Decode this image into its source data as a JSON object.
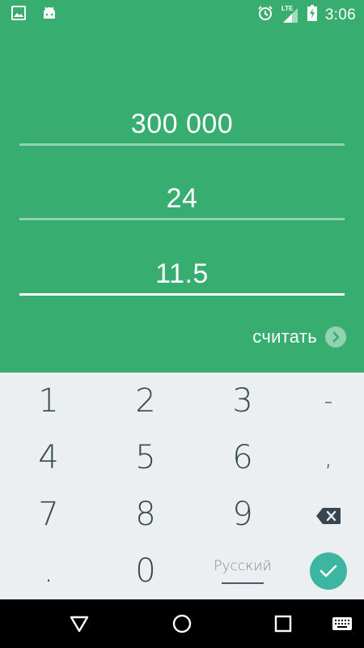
{
  "status_bar": {
    "time": "3:06",
    "network": "LTE",
    "icons": [
      "image-icon",
      "android-icon",
      "alarm-icon",
      "signal-icon",
      "battery-charging-icon"
    ]
  },
  "form": {
    "amount": "300 000",
    "term": "24",
    "rate": "11.5",
    "calculate_label": "считать"
  },
  "keyboard": {
    "rows": [
      [
        "1",
        "2",
        "3",
        "-"
      ],
      [
        "4",
        "5",
        "6",
        ","
      ],
      [
        "7",
        "8",
        "9",
        "⌫"
      ],
      [
        ".",
        "0",
        "Русский",
        "✓"
      ]
    ],
    "language": "Русский"
  },
  "colors": {
    "app_background": "#37ad6f",
    "keyboard_background": "#eceff1",
    "key_text": "#37474f",
    "enter_key": "#3cb6a0"
  }
}
